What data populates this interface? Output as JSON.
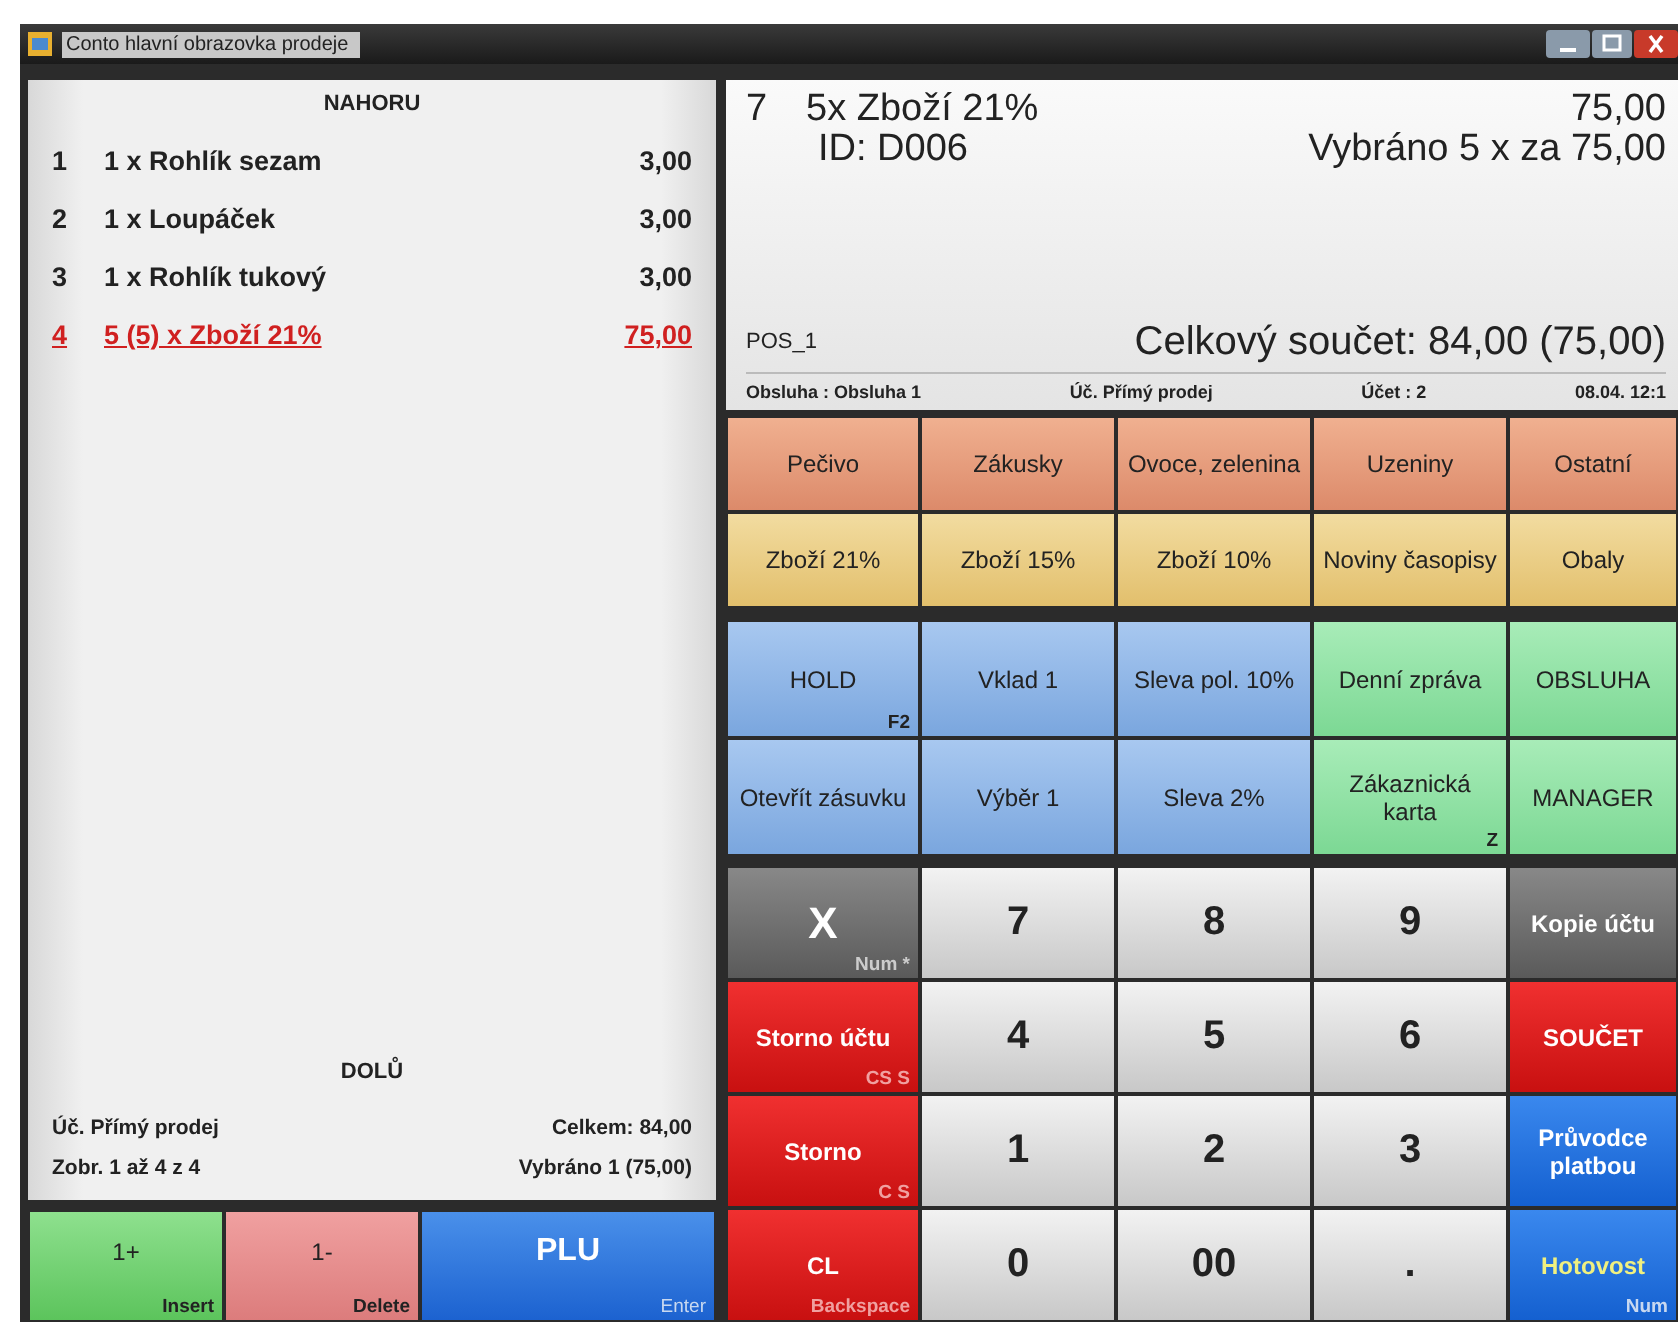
{
  "window": {
    "title": "Conto hlavní obrazovka prodeje"
  },
  "receipt": {
    "scroll_up": "NAHORU",
    "scroll_down": "DOLŮ",
    "items": [
      {
        "index": "1",
        "text": "1 x  Rohlík sezam",
        "price": "3,00",
        "selected": false
      },
      {
        "index": "2",
        "text": "1 x  Loupáček",
        "price": "3,00",
        "selected": false
      },
      {
        "index": "3",
        "text": "1 x  Rohlík tukový",
        "price": "3,00",
        "selected": false
      },
      {
        "index": "4",
        "text": "5 (5) x  Zboží 21%",
        "price": "75,00",
        "selected": true
      }
    ],
    "account": "Úč.  Přímý prodej",
    "total": "Celkem: 84,00",
    "shown": "Zobr.  1 až 4 z 4",
    "picked": "Vybráno 1 (75,00)"
  },
  "left_buttons": [
    {
      "label": "1+",
      "hotkey": "Insert",
      "kind": "green"
    },
    {
      "label": "1-",
      "hotkey": "Delete",
      "kind": "pink"
    },
    {
      "label": "PLU",
      "hotkey": "Enter",
      "kind": "blue"
    }
  ],
  "display": {
    "line": "7",
    "item": "5x  Zboží 21%",
    "amount": "75,00",
    "id": "ID: D006",
    "selection": "Vybráno 5 x za 75,00",
    "pos": "POS_1",
    "grand_total": "Celkový součet: 84,00 (75,00)",
    "status": [
      "Obsluha : Obsluha 1",
      "Úč. Přímý prodej",
      "Účet : 2",
      "08.04. 12:1"
    ]
  },
  "button_groups": [
    [
      {
        "label": "Pečivo",
        "kind": "orange"
      },
      {
        "label": "Zákusky",
        "kind": "orange"
      },
      {
        "label": "Ovoce, zelenina",
        "kind": "orange"
      },
      {
        "label": "Uzeniny",
        "kind": "orange"
      },
      {
        "label": "Ostatní",
        "kind": "orange"
      },
      {
        "label": "Zboží 21%",
        "kind": "yellow"
      },
      {
        "label": "Zboží 15%",
        "kind": "yellow"
      },
      {
        "label": "Zboží 10%",
        "kind": "yellow"
      },
      {
        "label": "Noviny časopisy",
        "kind": "yellow"
      },
      {
        "label": "Obaly",
        "kind": "yellow"
      }
    ],
    [
      {
        "label": "HOLD",
        "hotkey": "F2",
        "kind": "blue"
      },
      {
        "label": "Vklad 1",
        "kind": "blue"
      },
      {
        "label": "Sleva pol. 10%",
        "kind": "blue"
      },
      {
        "label": "Denní zpráva",
        "kind": "green"
      },
      {
        "label": "OBSLUHA",
        "kind": "green"
      },
      {
        "label": "Otevřít zásuvku",
        "kind": "blue"
      },
      {
        "label": "Výběr 1",
        "kind": "blue"
      },
      {
        "label": "Sleva 2%",
        "kind": "blue"
      },
      {
        "label": "Zákaznická karta",
        "hotkey": "Z",
        "kind": "green"
      },
      {
        "label": "MANAGER",
        "kind": "green"
      }
    ],
    [
      {
        "label": "X",
        "hotkey": "Num *",
        "kind": "gray"
      },
      {
        "label": "7",
        "kind": "key"
      },
      {
        "label": "8",
        "kind": "key"
      },
      {
        "label": "9",
        "kind": "key"
      },
      {
        "label": "Kopie účtu",
        "kind": "gray"
      },
      {
        "label": "Storno účtu",
        "hotkey": "CS S",
        "kind": "red"
      },
      {
        "label": "4",
        "kind": "key"
      },
      {
        "label": "5",
        "kind": "key"
      },
      {
        "label": "6",
        "kind": "key"
      },
      {
        "label": "SOUČET",
        "kind": "red"
      },
      {
        "label": "Storno",
        "hotkey": "C S",
        "kind": "red"
      },
      {
        "label": "1",
        "kind": "key"
      },
      {
        "label": "2",
        "kind": "key"
      },
      {
        "label": "3",
        "kind": "key"
      },
      {
        "label": "Průvodce platbou",
        "kind": "pay"
      },
      {
        "label": "CL",
        "hotkey": "Backspace",
        "kind": "red"
      },
      {
        "label": "0",
        "kind": "key"
      },
      {
        "label": "00",
        "kind": "key"
      },
      {
        "label": ".",
        "kind": "key"
      },
      {
        "label": "Hotovost",
        "hotkey": "Num",
        "kind": "cash"
      }
    ]
  ]
}
